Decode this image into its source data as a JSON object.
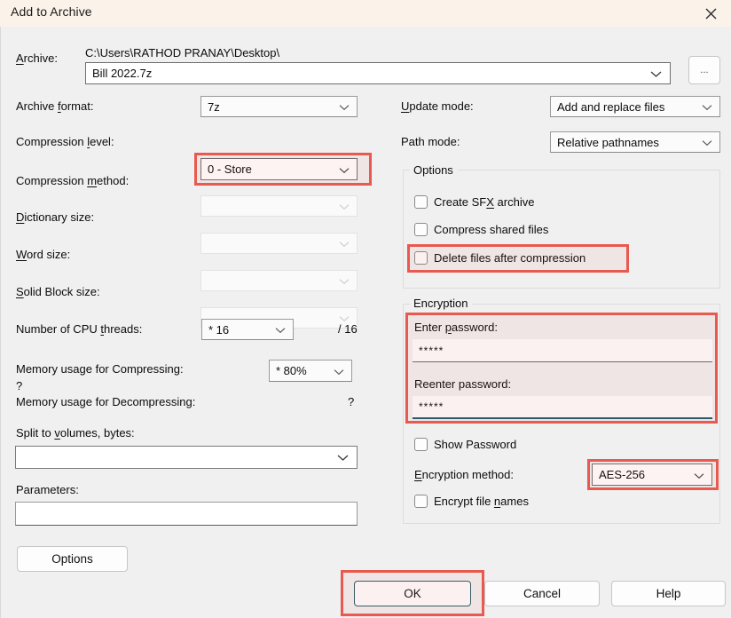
{
  "window": {
    "title": "Add to Archive",
    "close_icon": "close-icon"
  },
  "archive": {
    "label": "Archive:",
    "label_accel": "A",
    "path_text": "C:\\Users\\RATHOD PRANAY\\Desktop\\",
    "filename_value": "Bill 2022.7z",
    "browse_label": "..."
  },
  "left_fields": [
    {
      "label": "Archive format:",
      "accel": "f",
      "value": "7z",
      "enabled": true,
      "highlighted": false
    },
    {
      "label": "Compression level:",
      "accel": "l",
      "value": "0 - Store",
      "enabled": true,
      "highlighted": true
    },
    {
      "label": "Compression method:",
      "accel": "m",
      "value": "",
      "enabled": false,
      "highlighted": false
    },
    {
      "label": "Dictionary size:",
      "accel": "D",
      "value": "",
      "enabled": false,
      "highlighted": false
    },
    {
      "label": "Word size:",
      "accel": "W",
      "value": "",
      "enabled": false,
      "highlighted": false
    },
    {
      "label": "Solid Block size:",
      "accel": "S",
      "value": "",
      "enabled": false,
      "highlighted": false
    }
  ],
  "cpu": {
    "label": "Number of CPU threads:",
    "accel": "t",
    "value": "*  16",
    "total": "/ 16"
  },
  "memory_compress": {
    "label": "Memory usage for Compressing:",
    "value_unknown": "?",
    "value": "* 80%"
  },
  "memory_decompress": {
    "label": "Memory usage for Decompressing:",
    "value_unknown": "?"
  },
  "split": {
    "label": "Split to volumes, bytes:",
    "accel": "v",
    "value": ""
  },
  "parameters": {
    "label": "Parameters:",
    "value": ""
  },
  "options_button": {
    "label": "Options"
  },
  "update_mode": {
    "label": "Update mode:",
    "accel": "U",
    "value": "Add and replace files"
  },
  "path_mode": {
    "label": "Path mode:",
    "value": "Relative pathnames"
  },
  "options_group": {
    "title": "Options",
    "checkboxes": [
      {
        "label": "Create SFX archive",
        "checked": false,
        "highlighted": false
      },
      {
        "label": "Compress shared files",
        "checked": false,
        "highlighted": false
      },
      {
        "label": "Delete files after compression",
        "checked": false,
        "highlighted": true
      }
    ]
  },
  "encryption_group": {
    "title": "Encryption",
    "enter_password": {
      "label": "Enter password:",
      "accel": "p",
      "value": "*****"
    },
    "reenter_password": {
      "label": "Reenter password:",
      "value": "*****",
      "focused": true
    },
    "show_password": {
      "label": "Show Password",
      "checked": false
    },
    "encryption_method": {
      "label": "Encryption method:",
      "accel": "E",
      "value": "AES-256"
    },
    "encrypt_file_names": {
      "label": "Encrypt file names",
      "accel": "n",
      "checked": false
    }
  },
  "footer": {
    "ok_label": "OK",
    "cancel_label": "Cancel",
    "help_label": "Help"
  },
  "colors": {
    "titlebar_bg": "#fbf3ea",
    "dialog_bg": "#f0f0f0",
    "annotation_red": "#e8594f",
    "focus_teal": "#1f5c6e"
  }
}
